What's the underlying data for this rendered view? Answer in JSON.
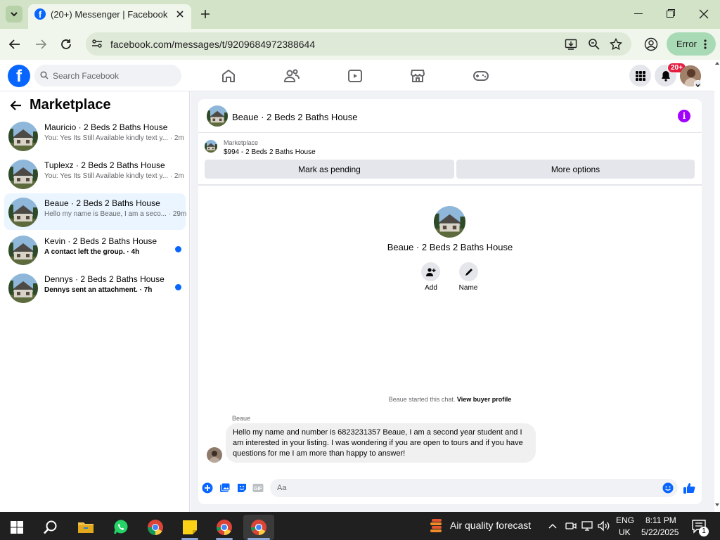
{
  "browser": {
    "tab_title": "(20+) Messenger | Facebook",
    "url": "facebook.com/messages/t/9209684972388644",
    "error_label": "Error"
  },
  "fb": {
    "logo_letter": "f",
    "search_placeholder": "Search Facebook",
    "notifications_badge": "20+"
  },
  "sidebar": {
    "title": "Marketplace",
    "conversations": [
      {
        "name": "Mauricio · 2 Beds 2 Baths House",
        "preview": "You: Yes Its Still Available kindly text y... · 2m",
        "unread": false,
        "selected": false
      },
      {
        "name": "Tuplexz · 2 Beds 2 Baths House",
        "preview": "You: Yes Its Still Available kindly text y... · 2m",
        "unread": false,
        "selected": false
      },
      {
        "name": "Beaue · 2 Beds 2 Baths House",
        "preview": "Hello my name is Beaue, I am a seco... · 29m",
        "unread": false,
        "selected": true
      },
      {
        "name": "Kevin · 2 Beds 2 Baths House",
        "preview": "A contact left the group. · 4h",
        "unread": true,
        "selected": false
      },
      {
        "name": "Dennys · 2 Beds 2 Baths House",
        "preview": "Dennys sent an attachment. · 7h",
        "unread": true,
        "selected": false
      }
    ]
  },
  "chat": {
    "header_name": "Beaue · 2 Beds 2 Baths House",
    "marketplace_label": "Marketplace",
    "listing_price": "$994 - 2 Beds 2 Baths House",
    "mark_pending": "Mark as pending",
    "more_options": "More options",
    "profile_name": "Beaue · 2 Beds 2 Baths House",
    "add_label": "Add",
    "name_label": "Name",
    "started_text": "Beaue started this chat.",
    "view_buyer": "View buyer profile",
    "sender": "Beaue",
    "message": "Hello my name and number is 6823231357 Beaue, I am a second year student and I am interested in your listing. I was wondering if you are open to tours and if you have questions for me I am more than happy to answer!",
    "composer_placeholder": "Aa"
  },
  "taskbar": {
    "weather": "Air quality forecast",
    "lang_line1": "ENG",
    "lang_line2": "UK",
    "time": "8:11 PM",
    "date": "5/22/2025",
    "notif_count": "1"
  },
  "colors": {
    "fb_blue": "#0866ff",
    "badge_red": "#e41e3f",
    "selected_bg": "#ebf5ff",
    "info_purple": "#a200ff"
  }
}
